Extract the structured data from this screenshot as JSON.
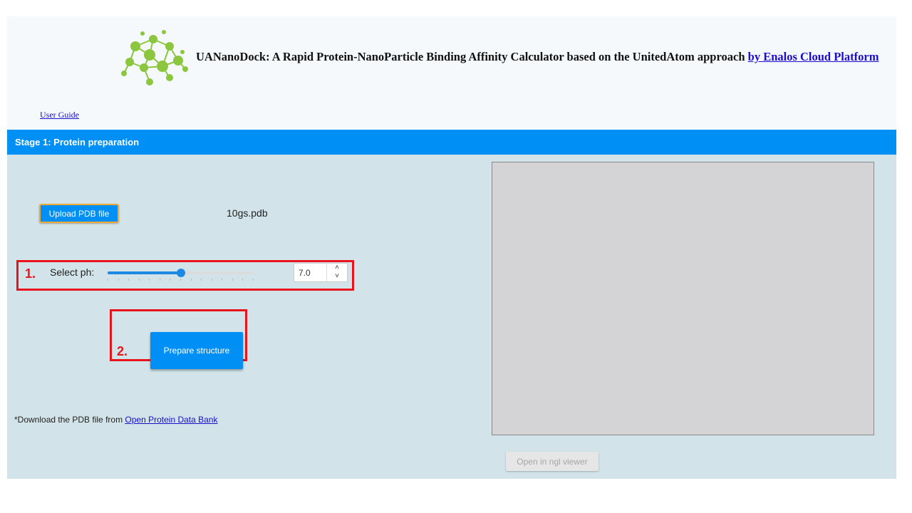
{
  "header": {
    "title": "UANanoDock: A Rapid Protein-NanoParticle Binding Affinity Calculator based on the UnitedAtom approach",
    "title_link": "by Enalos Cloud Platform",
    "user_guide": "User Guide"
  },
  "stage1": {
    "header": "Stage 1: Protein preparation",
    "upload_label": "Upload PDB file",
    "file_name": "10gs.pdb",
    "ph_label": "Select ph:",
    "ph_value": "7.0",
    "ph_min": 0,
    "ph_max": 14,
    "ph_fraction": 0.5,
    "prepare_label": "Prepare structure",
    "note_prefix": "*Download the PDB file from ",
    "note_link": "Open Protein Data Bank",
    "ngl_label": "Open in ngl viewer"
  },
  "annotations": {
    "step1": "1.",
    "step2": "2."
  },
  "colors": {
    "primary": "#0090f5",
    "highlight": "#e8141b",
    "panel_bg": "#d2e4e9",
    "logo_green": "#8cc63f"
  }
}
